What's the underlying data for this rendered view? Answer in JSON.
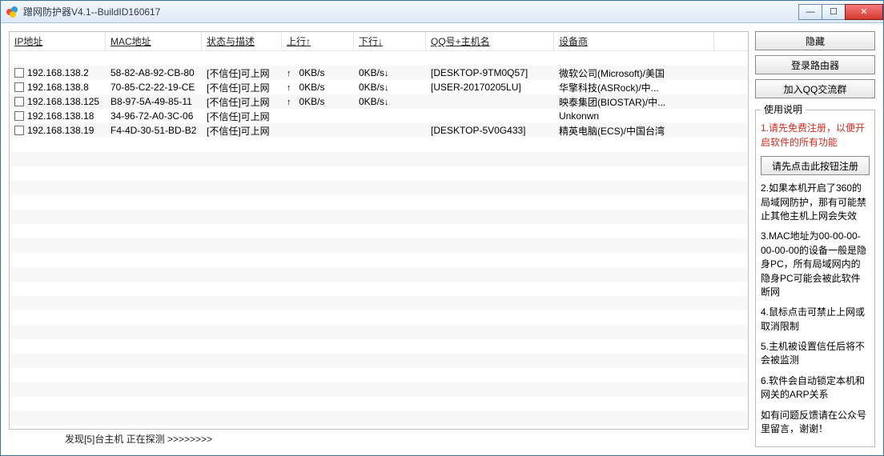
{
  "title": "蹭网防护器V4.1--BuildID160617",
  "win_btns": {
    "min": "—",
    "max": "☐",
    "close": "✕"
  },
  "columns": {
    "ip": "IP地址",
    "mac": "MAC地址",
    "status": "状态与描述",
    "up": "上行↑",
    "down": "下行↓",
    "host": "QQ号+主机名",
    "vendor": "设备商"
  },
  "rows": [
    {
      "ip": "192.168.138.2",
      "mac": "58-82-A8-92-CB-80",
      "status": "[不信任]可上网",
      "up_a": "↑",
      "up_v": "0KB/s",
      "down_v": "0KB/s",
      "down_a": "↓",
      "host": "[DESKTOP-9TM0Q57]",
      "vendor": "微软公司(Microsoft)/美国"
    },
    {
      "ip": "192.168.138.8",
      "mac": "70-85-C2-22-19-CE",
      "status": "[不信任]可上网",
      "up_a": "↑",
      "up_v": "0KB/s",
      "down_v": "0KB/s",
      "down_a": "↓",
      "host": "[USER-20170205LU]",
      "vendor": "华擎科技(ASRock)/中..."
    },
    {
      "ip": "192.168.138.125",
      "mac": "B8-97-5A-49-85-11",
      "status": "[不信任]可上网",
      "up_a": "↑",
      "up_v": "0KB/s",
      "down_v": "0KB/s",
      "down_a": "↓",
      "host": "",
      "vendor": "映泰集团(BIOSTAR)/中..."
    },
    {
      "ip": "192.168.138.18",
      "mac": "34-96-72-A0-3C-06",
      "status": "[不信任]可上网",
      "up_a": "",
      "up_v": "",
      "down_v": "",
      "down_a": "",
      "host": "",
      "vendor": "Unkonwn"
    },
    {
      "ip": "192.168.138.19",
      "mac": "F4-4D-30-51-BD-B2",
      "status": "[不信任]可上网",
      "up_a": "",
      "up_v": "",
      "down_v": "",
      "down_a": "",
      "host": "[DESKTOP-5V0G433]",
      "vendor": "精英电脑(ECS)/中国台湾"
    }
  ],
  "status_bar": "发现[5]台主机  正在探测 >>>>>>>>",
  "side": {
    "hide": "隐藏",
    "login_router": "登录路由器",
    "join_qq": "加入QQ交流群"
  },
  "help": {
    "legend": "使用说明",
    "p1": "1.请先免费注册，以便开启软件的所有功能",
    "reg_btn": "请先点击此按钮注册",
    "p2": "2.如果本机开启了360的局域网防护，那有可能禁止其他主机上网会失效",
    "p3": "3.MAC地址为00-00-00-00-00-00的设备一般是隐身PC，所有局域网内的隐身PC可能会被此软件断网",
    "p4": "4.鼠标点击可禁止上网或取消限制",
    "p5": "5.主机被设置信任后将不会被监测",
    "p6": "6.软件会自动锁定本机和网关的ARP关系",
    "p7": "如有问题反馈请在公众号里留言，谢谢！"
  }
}
